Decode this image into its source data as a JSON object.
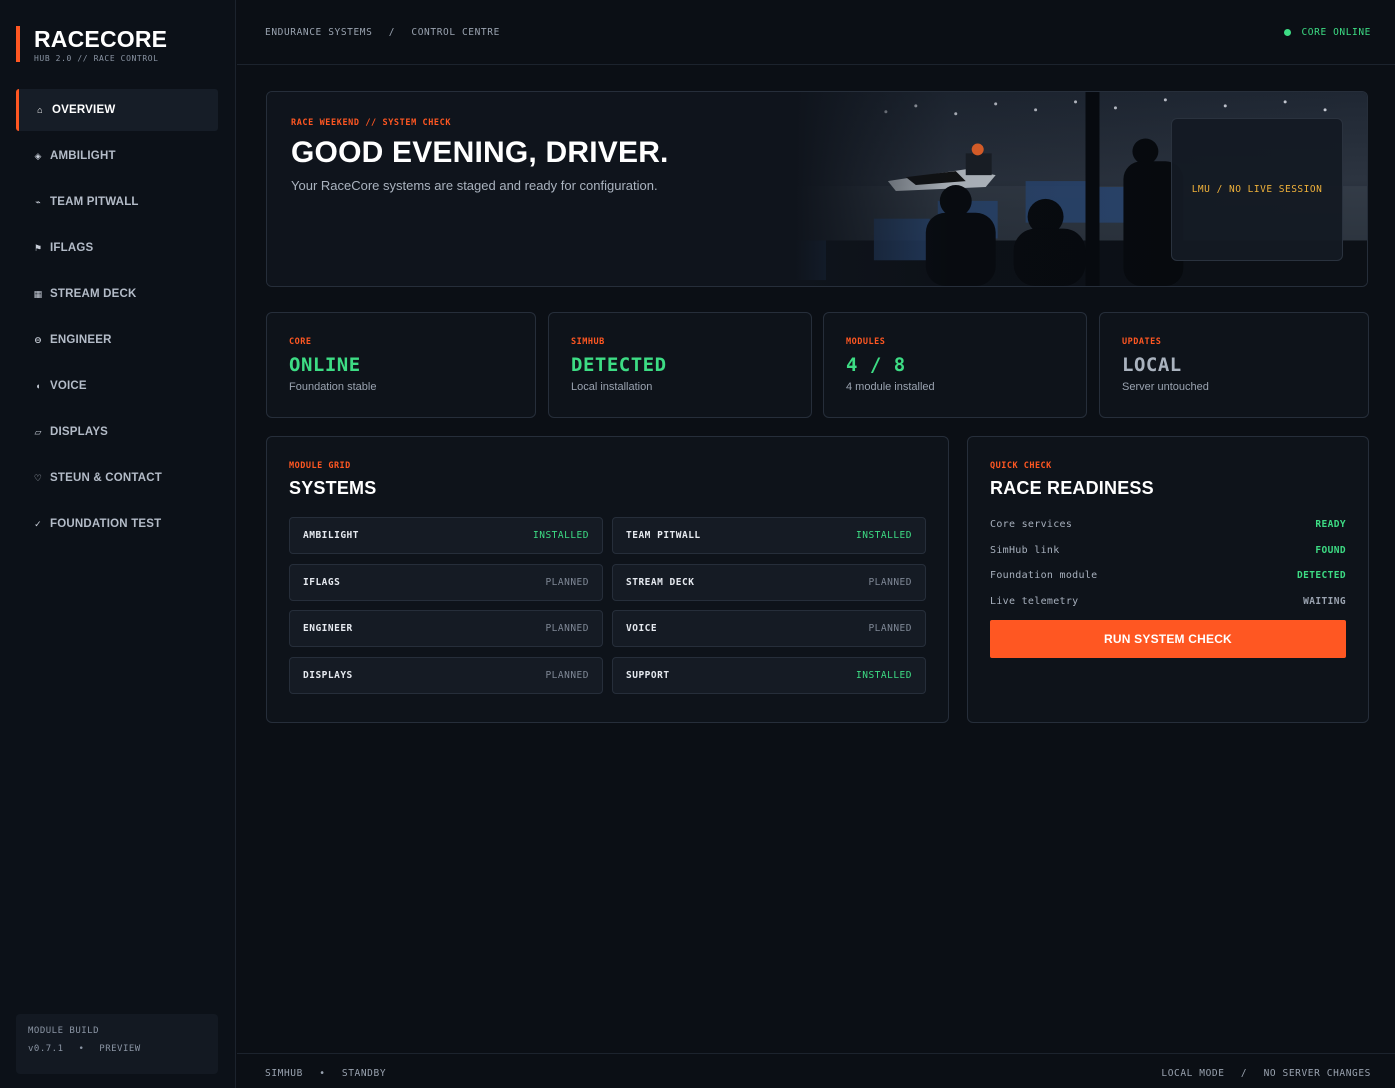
{
  "brand": {
    "title": "RACECORE",
    "subtitle": "HUB 2.0  //  RACE CONTROL",
    "accent": "#ff5722"
  },
  "nav": [
    {
      "id": "overview",
      "label": "OVERVIEW",
      "icon": "home-icon",
      "glyph": "⌂",
      "active": true
    },
    {
      "id": "ambilight",
      "label": "AMBILIGHT",
      "icon": "diamond-icon",
      "glyph": "◈",
      "active": false
    },
    {
      "id": "team-pitwall",
      "label": "TEAM PITWALL",
      "icon": "pulse-icon",
      "glyph": "⌁",
      "active": false
    },
    {
      "id": "iflags",
      "label": "IFLAGS",
      "icon": "flag-icon",
      "glyph": "⚑",
      "active": false
    },
    {
      "id": "stream-deck",
      "label": "STREAM DECK",
      "icon": "grid-icon",
      "glyph": "▦",
      "active": false
    },
    {
      "id": "engineer",
      "label": "ENGINEER",
      "icon": "headset-icon",
      "glyph": "⊖",
      "active": false
    },
    {
      "id": "voice",
      "label": "VOICE",
      "icon": "speaker-icon",
      "glyph": "◖",
      "active": false
    },
    {
      "id": "displays",
      "label": "DISPLAYS",
      "icon": "display-icon",
      "glyph": "▱",
      "active": false
    },
    {
      "id": "steun-contact",
      "label": "STEUN & CONTACT",
      "icon": "heart-icon",
      "glyph": "♡",
      "active": false
    },
    {
      "id": "foundation-test",
      "label": "FOUNDATION TEST",
      "icon": "check-icon",
      "glyph": "✓",
      "active": false
    }
  ],
  "build": {
    "title": "MODULE BUILD",
    "version": "v0.7.1",
    "channel": "PREVIEW"
  },
  "topbar": {
    "crumb1": "ENDURANCE SYSTEMS",
    "crumb_sep": "/",
    "crumb2": "CONTROL CENTRE",
    "status": "CORE ONLINE",
    "status_color": "#3ddc84"
  },
  "hero": {
    "kicker": "RACE WEEKEND // SYSTEM CHECK",
    "title": "GOOD EVENING, DRIVER.",
    "subtitle": "Your RaceCore systems are staged and ready for configuration.",
    "session": "LMU  /  NO LIVE SESSION"
  },
  "stats": [
    {
      "kicker": "CORE",
      "value": "ONLINE",
      "desc": "Foundation stable",
      "color": "#3ddc84"
    },
    {
      "kicker": "SIMHUB",
      "value": "DETECTED",
      "desc": "Local installation",
      "color": "#3ddc84"
    },
    {
      "kicker": "MODULES",
      "value": "4 / 8",
      "desc": "4 module installed",
      "color": "#3ddc84"
    },
    {
      "kicker": "UPDATES",
      "value": "LOCAL",
      "desc": "Server untouched",
      "color": "#aab3bf"
    }
  ],
  "systems": {
    "kicker": "MODULE GRID",
    "title": "SYSTEMS",
    "modules": [
      {
        "name": "AMBILIGHT",
        "status": "INSTALLED"
      },
      {
        "name": "TEAM PITWALL",
        "status": "INSTALLED"
      },
      {
        "name": "IFLAGS",
        "status": "PLANNED"
      },
      {
        "name": "STREAM DECK",
        "status": "PLANNED"
      },
      {
        "name": "ENGINEER",
        "status": "PLANNED"
      },
      {
        "name": "VOICE",
        "status": "PLANNED"
      },
      {
        "name": "DISPLAYS",
        "status": "PLANNED"
      },
      {
        "name": "SUPPORT",
        "status": "INSTALLED"
      }
    ]
  },
  "readiness": {
    "kicker": "QUICK CHECK",
    "title": "RACE READINESS",
    "rows": [
      {
        "label": "Core services",
        "value": "READY",
        "color": "#3ddc84"
      },
      {
        "label": "SimHub link",
        "value": "FOUND",
        "color": "#3ddc84"
      },
      {
        "label": "Foundation module",
        "value": "DETECTED",
        "color": "#3ddc84"
      },
      {
        "label": "Live telemetry",
        "value": "WAITING",
        "color": "#9aa3b0"
      }
    ],
    "button": "RUN SYSTEM CHECK"
  },
  "footer": {
    "left1": "SIMHUB",
    "left_sep": "•",
    "left2": "STANDBY",
    "right1": "LOCAL MODE",
    "right_sep": "/",
    "right2": "NO SERVER CHANGES"
  }
}
